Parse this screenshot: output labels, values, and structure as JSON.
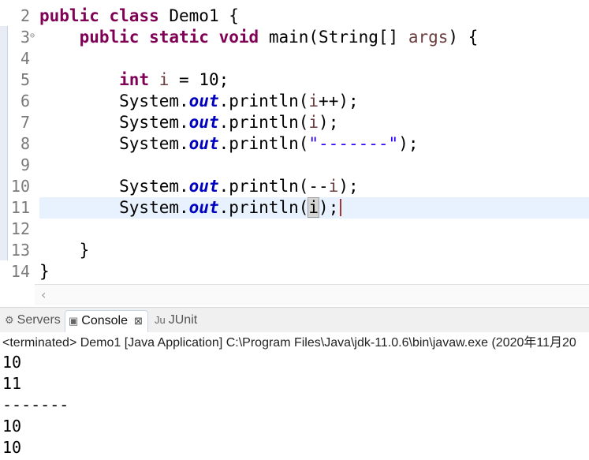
{
  "editor": {
    "line_numbers": [
      "2",
      "3",
      "4",
      "5",
      "6",
      "7",
      "8",
      "9",
      "10",
      "11",
      "12",
      "13",
      "14"
    ],
    "fold_marker": "⊖",
    "lines": [
      {
        "segments": [
          {
            "t": "public",
            "c": "kw"
          },
          {
            "t": " "
          },
          {
            "t": "class",
            "c": "kw"
          },
          {
            "t": " Demo1 {"
          }
        ]
      },
      {
        "segments": [
          {
            "t": "    "
          },
          {
            "t": "public",
            "c": "kw"
          },
          {
            "t": " "
          },
          {
            "t": "static",
            "c": "kw"
          },
          {
            "t": " "
          },
          {
            "t": "void",
            "c": "kw"
          },
          {
            "t": " main(String[] "
          },
          {
            "t": "args",
            "c": "var"
          },
          {
            "t": ") {"
          }
        ]
      },
      {
        "segments": [
          {
            "t": ""
          }
        ]
      },
      {
        "segments": [
          {
            "t": "        "
          },
          {
            "t": "int",
            "c": "kw"
          },
          {
            "t": " "
          },
          {
            "t": "i",
            "c": "var"
          },
          {
            "t": " = 10;"
          }
        ]
      },
      {
        "segments": [
          {
            "t": "        System."
          },
          {
            "t": "out",
            "c": "fld"
          },
          {
            "t": ".println("
          },
          {
            "t": "i",
            "c": "var"
          },
          {
            "t": "++);"
          }
        ]
      },
      {
        "segments": [
          {
            "t": "        System."
          },
          {
            "t": "out",
            "c": "fld"
          },
          {
            "t": ".println("
          },
          {
            "t": "i",
            "c": "var"
          },
          {
            "t": ");"
          }
        ]
      },
      {
        "segments": [
          {
            "t": "        System."
          },
          {
            "t": "out",
            "c": "fld"
          },
          {
            "t": ".println("
          },
          {
            "t": "\"-------\"",
            "c": "str"
          },
          {
            "t": ");"
          }
        ]
      },
      {
        "segments": [
          {
            "t": ""
          }
        ]
      },
      {
        "segments": [
          {
            "t": "        System."
          },
          {
            "t": "out",
            "c": "fld"
          },
          {
            "t": ".println(--"
          },
          {
            "t": "i",
            "c": "var"
          },
          {
            "t": ");"
          }
        ]
      },
      {
        "segments": [
          {
            "t": "        System."
          },
          {
            "t": "out",
            "c": "fld"
          },
          {
            "t": ".println("
          },
          {
            "t": "i",
            "c": "hlvar"
          },
          {
            "t": ");"
          }
        ],
        "current": true,
        "caret": true
      },
      {
        "segments": [
          {
            "t": ""
          }
        ]
      },
      {
        "segments": [
          {
            "t": "    }"
          }
        ]
      },
      {
        "segments": [
          {
            "t": "}"
          }
        ]
      }
    ],
    "scroll_left_arrow": "‹"
  },
  "tabs": [
    {
      "label": "Servers",
      "icon": "servers-icon",
      "glyph": "⚙",
      "active": false
    },
    {
      "label": "Console",
      "icon": "console-icon",
      "glyph": "▣",
      "active": true,
      "close": "⊠"
    },
    {
      "label": "JUnit",
      "icon": "junit-icon",
      "glyph": "Ju",
      "active": false
    }
  ],
  "console": {
    "status": "<terminated> Demo1 [Java Application] C:\\Program Files\\Java\\jdk-11.0.6\\bin\\javaw.exe (2020年11月20",
    "output": [
      "10",
      "11",
      "-------",
      "10",
      "10"
    ]
  }
}
